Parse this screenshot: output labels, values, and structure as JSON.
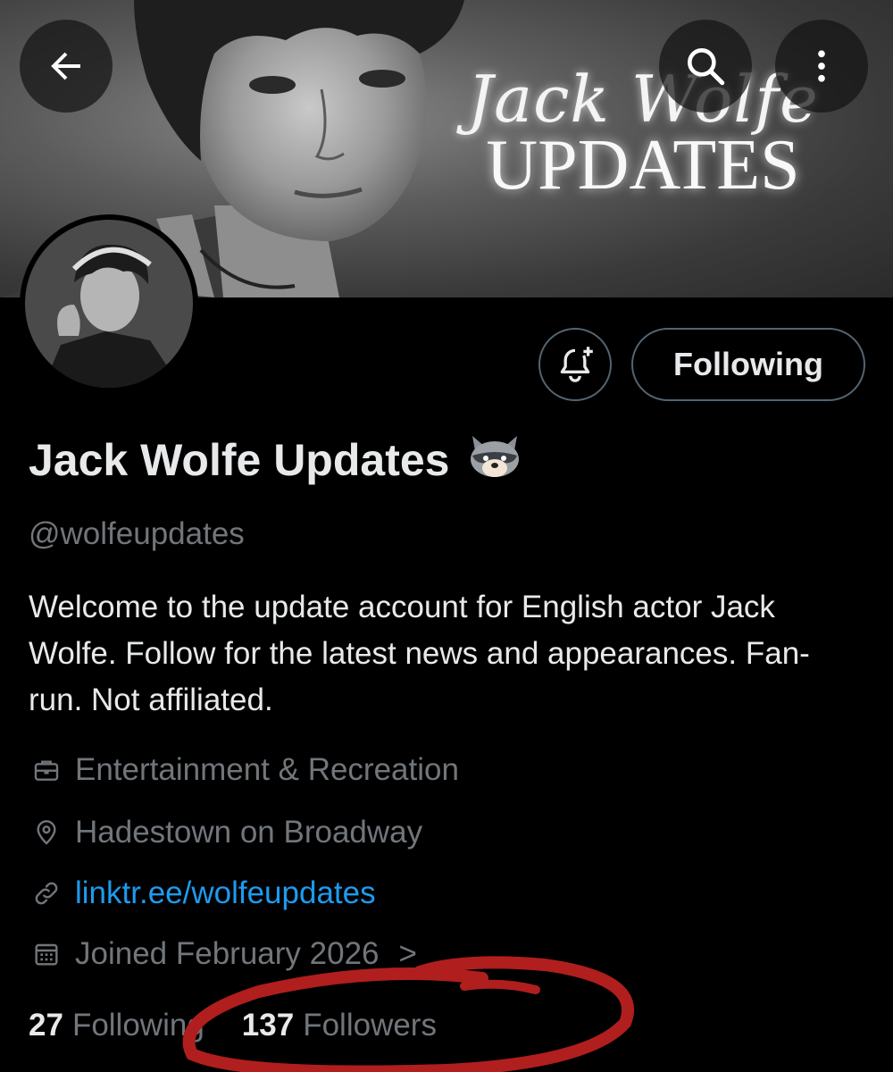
{
  "banner": {
    "script_text": "Jack Wolfe",
    "caps_text": "UPDATES"
  },
  "header": {
    "back_icon": "arrow-left-icon",
    "search_icon": "search-icon",
    "more_icon": "more-vertical-icon"
  },
  "actions": {
    "notify_icon": "bell-plus-icon",
    "following_label": "Following"
  },
  "profile": {
    "display_name": "Jack Wolfe Updates",
    "emoji": "raccoon-emoji",
    "handle": "@wolfeupdates",
    "bio": "Welcome to the update account for English actor Jack Wolfe. Follow for the latest news and appearances.  Fan-run. Not affiliated.",
    "category": "Entertainment & Recreation",
    "location": "Hadestown on Broadway",
    "link": "linktr.ee/wolfeupdates",
    "joined": "Joined February 2026",
    "joined_chevron": ">"
  },
  "stats": {
    "following_count": "27",
    "following_label": "Following",
    "followers_count": "137",
    "followers_label": "Followers"
  },
  "colors": {
    "background": "#000000",
    "text_primary": "#e7e9ea",
    "text_secondary": "#71767b",
    "link": "#1d9bf0",
    "border": "#536471",
    "annotation_circle": "#b01e1e"
  }
}
